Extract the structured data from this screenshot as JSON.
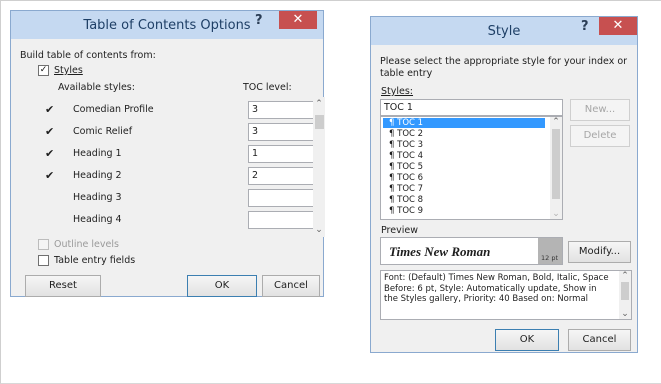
{
  "toc_options": {
    "title": "Table of Contents Options",
    "help_glyph": "?",
    "close_glyph": "✕",
    "build_label": "Build table of contents from:",
    "styles_checkbox": {
      "label": "Styles",
      "checked": true
    },
    "available_styles_label": "Available styles:",
    "toc_level_label": "TOC level:",
    "rows": [
      {
        "name": "Comedian Profile",
        "checked": true,
        "level": "3"
      },
      {
        "name": "Comic Relief",
        "checked": true,
        "level": "3"
      },
      {
        "name": "Heading 1",
        "checked": true,
        "level": "1"
      },
      {
        "name": "Heading 2",
        "checked": true,
        "level": "2"
      },
      {
        "name": "Heading 3",
        "checked": false,
        "level": ""
      },
      {
        "name": "Heading 4",
        "checked": false,
        "level": ""
      }
    ],
    "outline_levels": {
      "label": "Outline levels",
      "checked": false,
      "enabled": false
    },
    "table_entry_fields": {
      "label": "Table entry fields",
      "checked": false
    },
    "reset_label": "Reset",
    "ok_label": "OK",
    "cancel_label": "Cancel"
  },
  "style_dialog": {
    "title": "Style",
    "help_glyph": "?",
    "close_glyph": "✕",
    "prompt": "Please select the appropriate style for your index or table entry",
    "styles_label": "Styles:",
    "style_input_value": "TOC 1",
    "style_items": [
      "TOC 1",
      "TOC 2",
      "TOC 3",
      "TOC 4",
      "TOC 5",
      "TOC 6",
      "TOC 7",
      "TOC 8",
      "TOC 9"
    ],
    "selected_index": 0,
    "para_mark": "¶",
    "new_label": "New...",
    "delete_label": "Delete",
    "preview_label": "Preview",
    "preview_font": "Times New Roman",
    "preview_size": "12 pt",
    "modify_label": "Modify...",
    "description": "Font: (Default) Times New Roman, Bold, Italic, Space Before: 6 pt, Style: Automatically update, Show in the Styles gallery, Priority: 40 Based on: Normal",
    "ok_label": "OK",
    "cancel_label": "Cancel"
  },
  "colors": {
    "titlebar": "#c5d9f1",
    "close": "#c75050",
    "selection": "#3399ff"
  }
}
